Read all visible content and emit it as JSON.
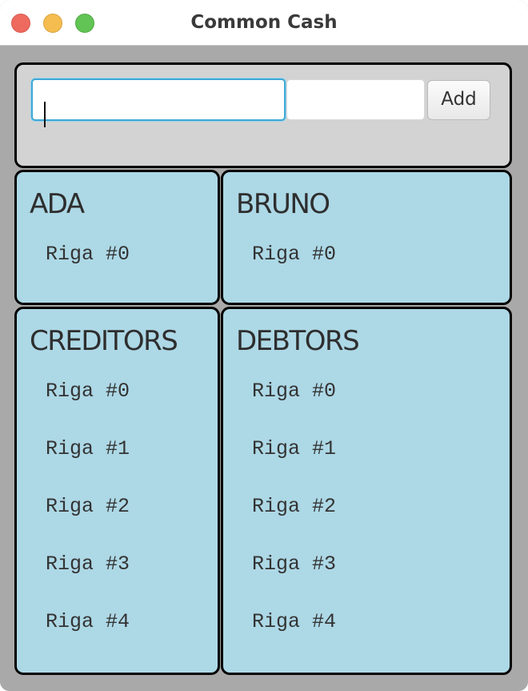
{
  "window": {
    "title": "Common Cash"
  },
  "form": {
    "name_value": "",
    "amount_value": "",
    "add_label": "Add"
  },
  "panels": {
    "ada": {
      "title": "ADA",
      "rows": [
        "Riga #0"
      ]
    },
    "bruno": {
      "title": "BRUNO",
      "rows": [
        "Riga #0"
      ]
    },
    "creditors": {
      "title": "CREDITORS",
      "rows": [
        "Riga #0",
        "Riga #1",
        "Riga #2",
        "Riga #3",
        "Riga #4"
      ]
    },
    "debtors": {
      "title": "DEBTORS",
      "rows": [
        "Riga #0",
        "Riga #1",
        "Riga #2",
        "Riga #3",
        "Riga #4"
      ]
    }
  },
  "colors": {
    "panel_background": "#add8e6",
    "form_background": "#d3d3d3",
    "window_background": "#a9a9a9",
    "focus_ring": "#3ea8d6"
  }
}
